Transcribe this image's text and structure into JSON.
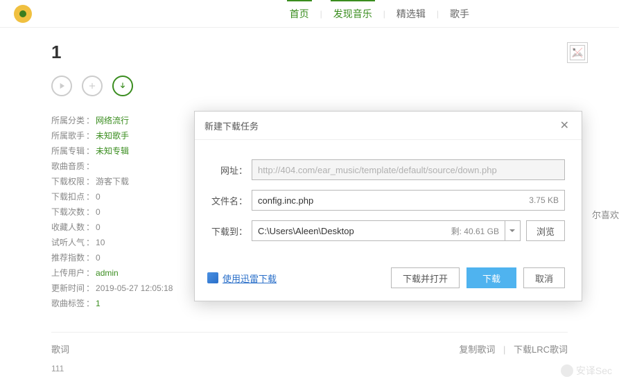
{
  "nav": {
    "home": "首页",
    "discover": "发现音乐",
    "albums": "精选辑",
    "artists": "歌手"
  },
  "song": {
    "title": "1"
  },
  "info": {
    "category_label": "所属分类",
    "category_value": "网络流行",
    "artist_label": "所属歌手",
    "artist_value": "未知歌手",
    "album_label": "所属专辑",
    "album_value": "未知专辑",
    "quality_label": "歌曲音质",
    "quality_value": "",
    "perm_label": "下载权限",
    "perm_value": "游客下载",
    "points_label": "下载扣点",
    "points_value": "0",
    "downloads_label": "下载次数",
    "downloads_value": "0",
    "favs_label": "收藏人数",
    "favs_value": "0",
    "plays_label": "试听人气",
    "plays_value": "10",
    "rec_label": "推荐指数",
    "rec_value": "0",
    "uploader_label": "上传用户",
    "uploader_value": "admin",
    "updated_label": "更新时间",
    "updated_value": "2019-05-27 12:05:18",
    "tags_label": "歌曲标签",
    "tags_value": "1"
  },
  "partial_side": "尔喜欢",
  "lyric": {
    "label": "歌词",
    "copy": "复制歌词",
    "download_lrc": "下载LRC歌词",
    "content": "111"
  },
  "dialog": {
    "title": "新建下载任务",
    "url_label": "网址：",
    "url_value": "http://404.com/ear_music/template/default/source/down.php",
    "filename_label": "文件名：",
    "filename_value": "config.inc.php",
    "filesize": "3.75 KB",
    "saveto_label": "下载到：",
    "saveto_value": "C:\\Users\\Aleen\\Desktop",
    "remaining": "剩: 40.61 GB",
    "browse": "浏览",
    "thunder": "使用迅雷下载",
    "download_open": "下载并打开",
    "download": "下载",
    "cancel": "取消"
  },
  "watermark": "安译Sec"
}
